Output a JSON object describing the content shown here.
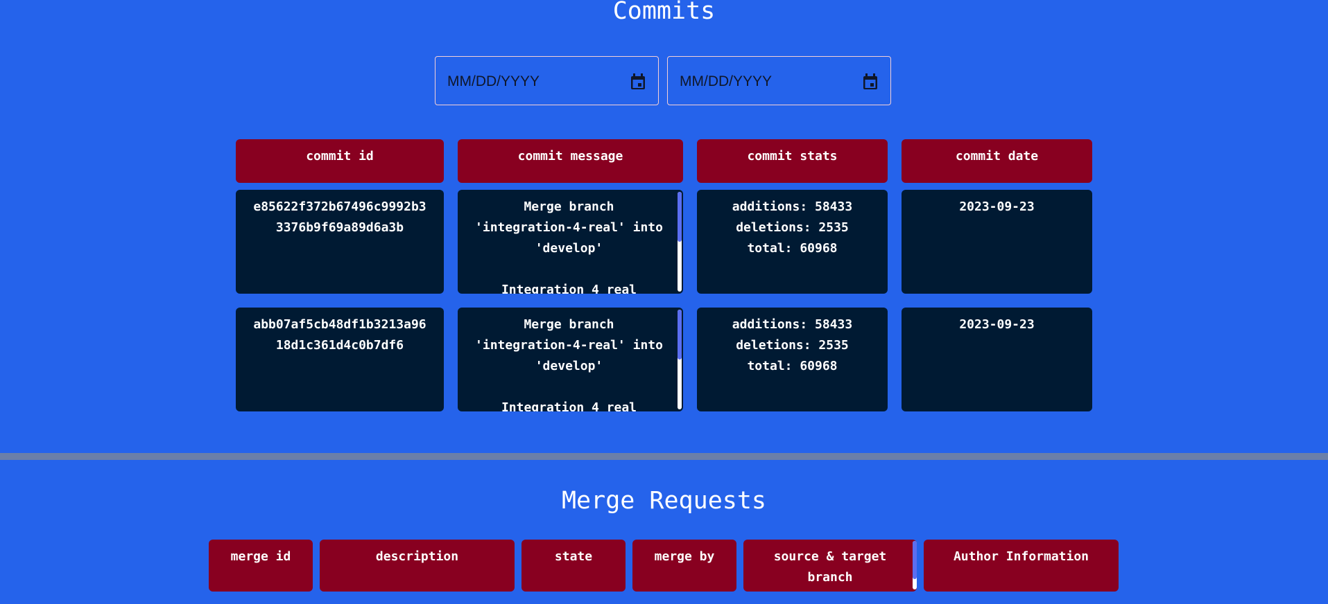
{
  "commits": {
    "title": "Commits",
    "date_filters": {
      "start_placeholder": "MM/DD/YYYY",
      "end_placeholder": "MM/DD/YYYY"
    },
    "columns": [
      "commit id",
      "commit message",
      "commit stats",
      "commit date"
    ],
    "rows": [
      {
        "id": "e85622f372b67496c9992b3\n3376b9f69a89d6a3b",
        "message": "Merge branch\n'integration-4-real' into\n'develop'\n\nIntegration 4 real",
        "stats": "additions: 58433\ndeletions: 2535\ntotal: 60968",
        "date": "2023-09-23"
      },
      {
        "id": "abb07af5cb48df1b3213a96\n18d1c361d4c0b7df6",
        "message": "Merge branch\n'integration-4-real' into\n'develop'\n\nIntegration 4 real",
        "stats": "additions: 58433\ndeletions: 2535\ntotal: 60968",
        "date": "2023-09-23"
      }
    ]
  },
  "merge_requests": {
    "title": "Merge Requests",
    "columns": [
      "merge id",
      "description",
      "state",
      "merge by",
      "source & target branch",
      "Author Information"
    ]
  },
  "colors": {
    "background": "#2563eb",
    "header_cell": "#880020",
    "data_cell": "#001a33",
    "divider": "#6b7fa8"
  }
}
